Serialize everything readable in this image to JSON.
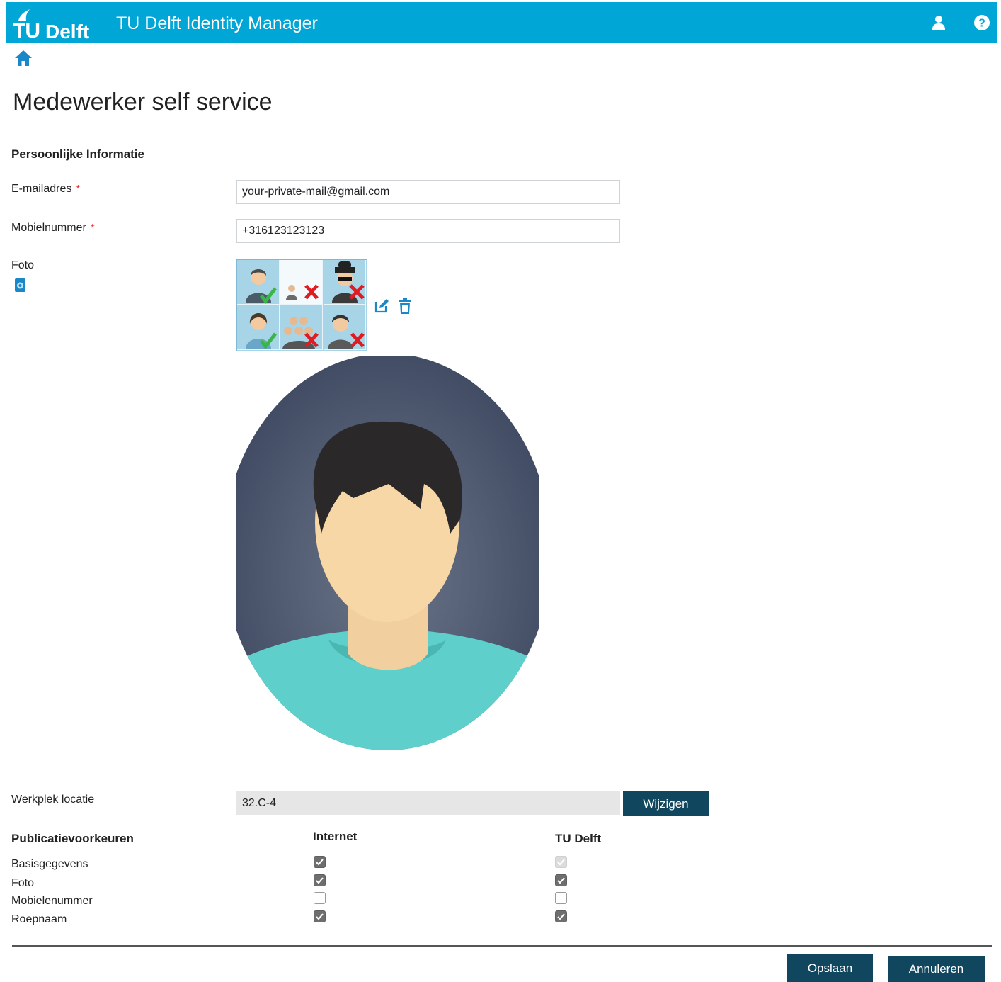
{
  "header": {
    "logo_tu": "TU",
    "logo_delft": "Delft",
    "app_title": "TU Delft Identity Manager",
    "bg_color": "#00a6d6"
  },
  "page": {
    "title": "Medewerker self service"
  },
  "personal": {
    "section_title": "Persoonlijke Informatie",
    "email": {
      "label": "E-mailadres",
      "required_mark": "*",
      "value": "your-private-mail@gmail.com"
    },
    "mobile": {
      "label": "Mobielnummer",
      "required_mark": "*",
      "value": "+316123123123"
    },
    "photo": {
      "label": "Foto"
    }
  },
  "workplace": {
    "label": "Werkplek locatie",
    "value": "32.C-4",
    "button": "Wijzigen"
  },
  "publication": {
    "section_title": "Publicatievoorkeuren",
    "col_internet": "Internet",
    "col_tudelft": "TU Delft",
    "rows": [
      {
        "label": "Basisgegevens",
        "internet": "checked",
        "tudelft": "disabled-checked"
      },
      {
        "label": "Foto",
        "internet": "checked",
        "tudelft": "checked"
      },
      {
        "label": "Mobielenummer",
        "internet": "unchecked",
        "tudelft": "unchecked"
      },
      {
        "label": "Roepnaam",
        "internet": "checked",
        "tudelft": "checked"
      }
    ]
  },
  "footer": {
    "save": "Opslaan",
    "cancel": "Annuleren"
  },
  "colors": {
    "accent": "#00a6d6",
    "button": "#10475f",
    "required": "#e33333"
  }
}
